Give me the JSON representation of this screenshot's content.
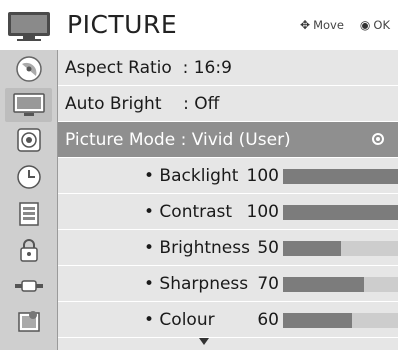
{
  "header": {
    "title": "PICTURE",
    "move_hint": "Move",
    "ok_hint": "OK",
    "icon": "tv-monitor-icon",
    "move_glyph": "✥",
    "ok_glyph": "◉"
  },
  "sidebar": {
    "items": [
      {
        "icon": "satellite-dish-icon"
      },
      {
        "icon": "tv-picture-icon",
        "selected": true
      },
      {
        "icon": "speaker-audio-icon"
      },
      {
        "icon": "clock-time-icon"
      },
      {
        "icon": "option-list-icon"
      },
      {
        "icon": "lock-icon"
      },
      {
        "icon": "input-plug-icon"
      },
      {
        "icon": "photo-media-icon"
      }
    ]
  },
  "menu": {
    "aspect_ratio": "Aspect Ratio  : 16:9",
    "auto_bright": "Auto Bright    : Off",
    "picture_mode": "Picture Mode : Vivid (User)"
  },
  "settings": [
    {
      "name": "• Backlight",
      "value": "100",
      "level": 100
    },
    {
      "name": "• Contrast",
      "value": "100",
      "level": 100
    },
    {
      "name": "• Brightness",
      "value": "50",
      "level": 50
    },
    {
      "name": "• Sharpness",
      "value": "70",
      "level": 70
    },
    {
      "name": "• Colour",
      "value": "60",
      "level": 60
    }
  ],
  "colors": {
    "selected_row": "#8f8f8f",
    "list_bg": "#e6e6e6",
    "rail_bg": "#cfcfcf",
    "bar_fill": "#7c7c7c",
    "bar_track": "#cdcdcd"
  }
}
